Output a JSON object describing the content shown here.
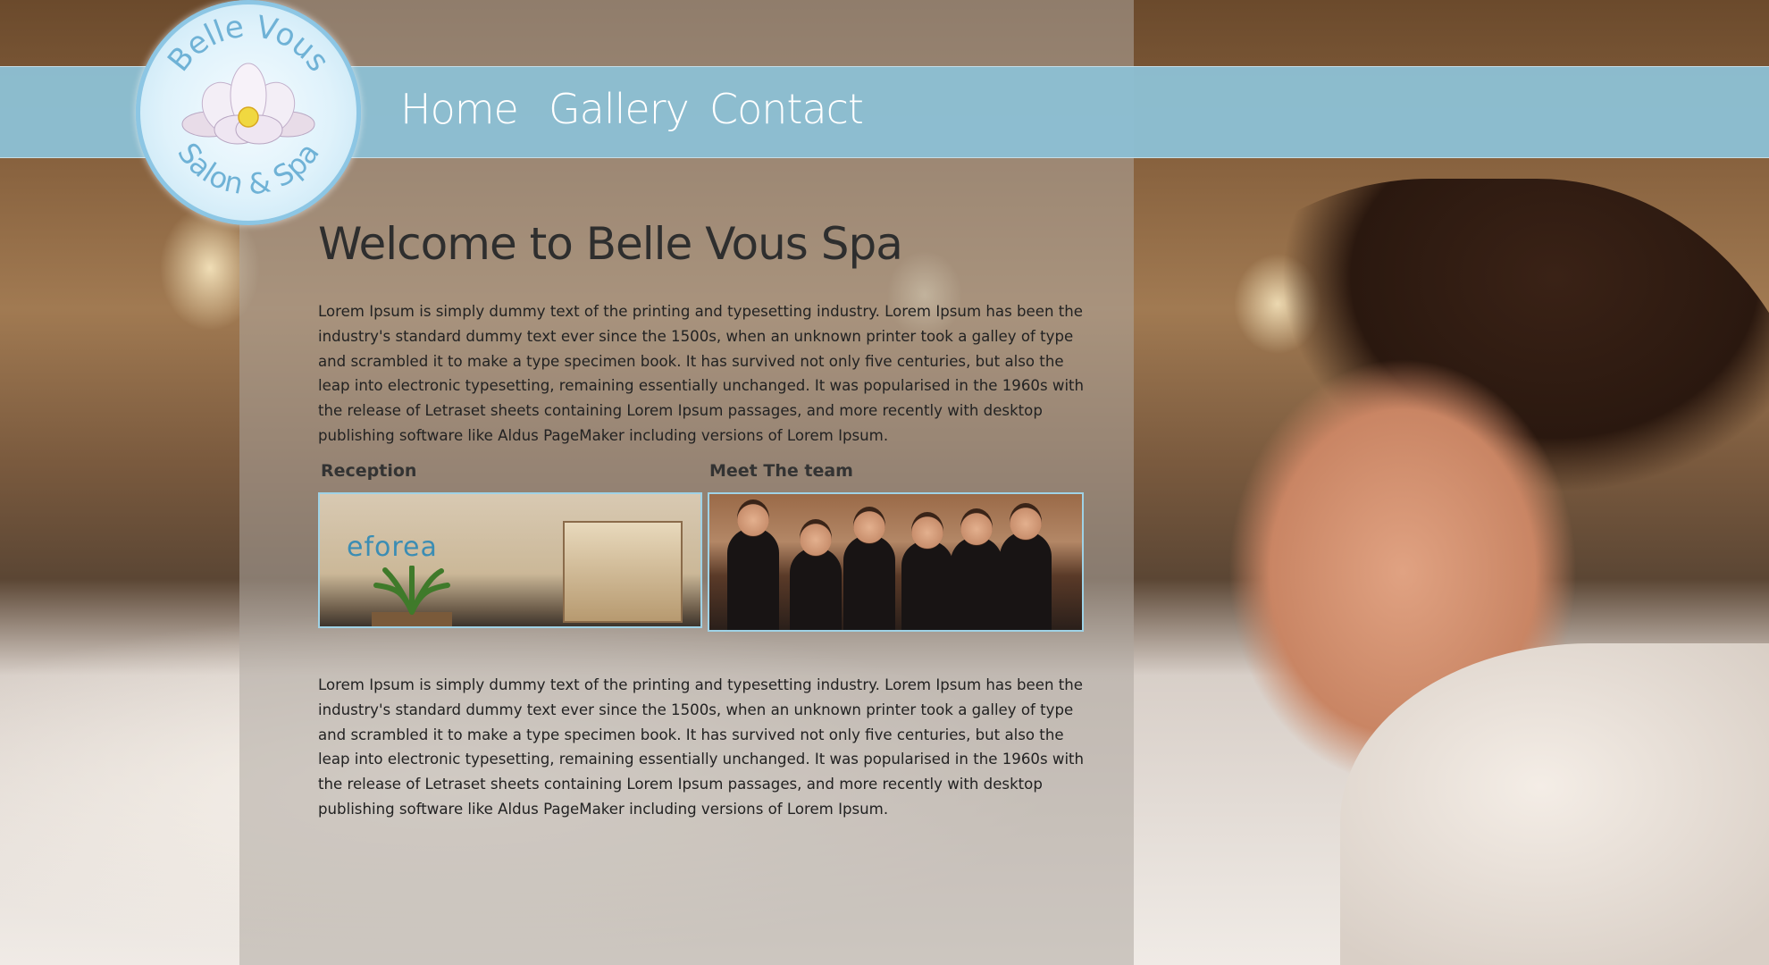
{
  "logo": {
    "text_top": "Belle Vous",
    "text_bottom": "Salon & Spa",
    "icon": "lotus-flower-icon"
  },
  "nav": {
    "items": [
      {
        "label": "Home"
      },
      {
        "label": "Gallery"
      },
      {
        "label": "Contact"
      }
    ]
  },
  "main": {
    "title": "Welcome to Belle Vous Spa",
    "paragraph1": "Lorem Ipsum is simply dummy text of the printing and typesetting industry. Lorem Ipsum has been the industry's standard dummy text ever since the 1500s, when an unknown printer took a galley of type and scrambled it to make a type specimen book. It has survived not only five centuries, but also the leap into electronic typesetting, remaining essentially unchanged. It was popularised in the 1960s with the release of Letraset sheets containing Lorem Ipsum passages, and more recently with desktop publishing software like Aldus PageMaker including versions of Lorem Ipsum.",
    "paragraph2": "Lorem Ipsum is simply dummy text of the printing and typesetting industry. Lorem Ipsum has been the industry's standard dummy text ever since the 1500s, when an unknown printer took a galley of type and scrambled it to make a type specimen book. It has survived not only five centuries, but also the leap into electronic typesetting, remaining essentially unchanged. It was popularised in the 1960s with the release of Letraset sheets containing Lorem Ipsum passages, and more recently with desktop publishing software like Aldus PageMaker including versions of Lorem Ipsum."
  },
  "sections": {
    "reception": {
      "label": "Reception",
      "sign_text": "eforea"
    },
    "team": {
      "label": "Meet The team"
    }
  },
  "colors": {
    "nav_bar": "#8cbfd3",
    "logo_ring": "#8cc6e4",
    "title_text": "#2e2e2e",
    "thumb_border": "#9fd2e6"
  }
}
